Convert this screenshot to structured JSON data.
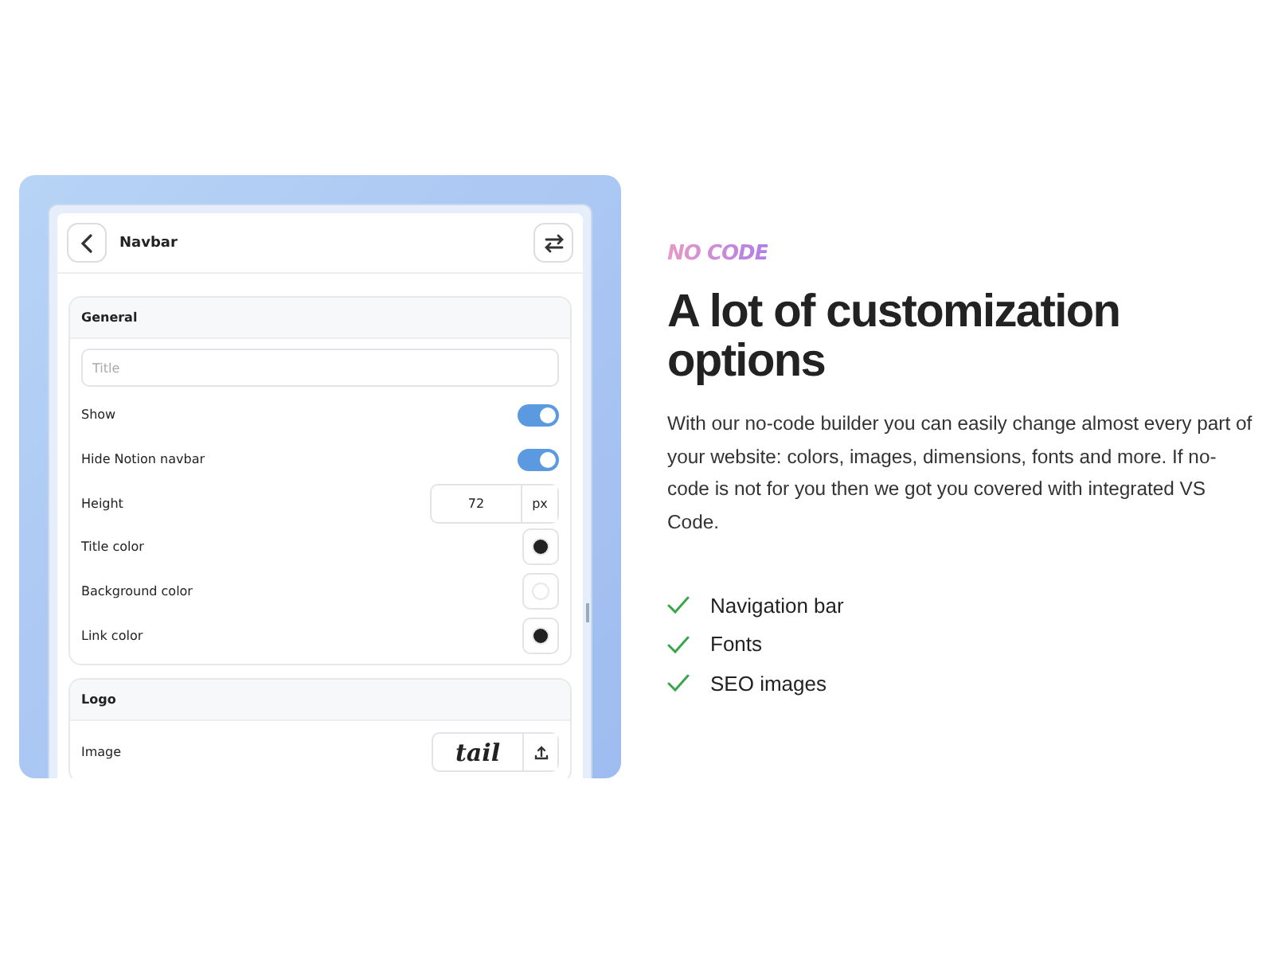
{
  "editor": {
    "title": "Navbar",
    "sections": [
      {
        "title": "General",
        "rows": [
          {
            "kind": "input",
            "placeholder": "Title"
          },
          {
            "kind": "toggle",
            "label": "Show",
            "on": true
          },
          {
            "kind": "toggle",
            "label": "Hide Notion navbar",
            "on": true
          },
          {
            "kind": "number",
            "label": "Height",
            "value": "72",
            "unit": "px"
          },
          {
            "kind": "color",
            "label": "Title color",
            "color": "#222222"
          },
          {
            "kind": "color",
            "label": "Background color",
            "color": "#ffffff"
          },
          {
            "kind": "color",
            "label": "Link color",
            "color": "#222222"
          }
        ]
      },
      {
        "title": "Logo",
        "rows": [
          {
            "kind": "image",
            "label": "Image",
            "logo": "tail"
          }
        ]
      }
    ]
  },
  "feature": {
    "eyebrow": "NO CODE",
    "heading": "A lot of customization options",
    "description": "With our no-code builder you can easily change almost every part of your website: colors, images, dimensions, fonts and more. If no-code is not for you then we got you covered with integrated VS Code.",
    "items": [
      "Navigation bar",
      "Fonts",
      "SEO images"
    ]
  }
}
